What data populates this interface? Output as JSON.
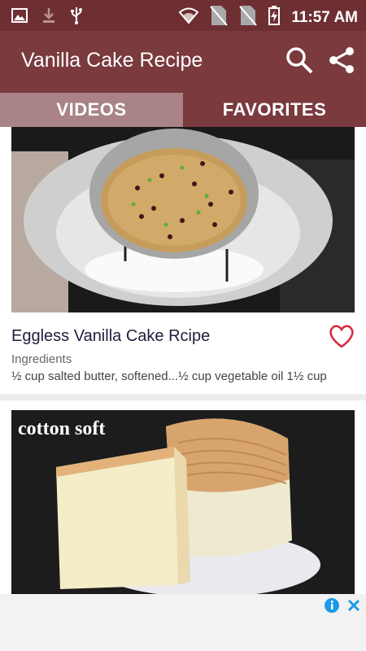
{
  "status_bar": {
    "time": "11:57 AM",
    "icons": [
      "image-icon",
      "download-icon",
      "usb-icon",
      "wifi-icon",
      "no-sim-icon",
      "no-sim-icon",
      "battery-charging-icon"
    ]
  },
  "app_bar": {
    "title": "Vanilla Cake Recipe",
    "icons": [
      "search-icon",
      "share-icon"
    ]
  },
  "tabs": [
    {
      "label": "VIDEOS",
      "active": false
    },
    {
      "label": "FAVORITES",
      "active": true
    }
  ],
  "recipes": [
    {
      "title": "Eggless Vanilla Cake Rcipe",
      "section": "Ingredients",
      "preview": "½ cup salted butter, softened...½ cup vegetable oil 1½ cup",
      "favorite_icon": "heart-outline-icon"
    },
    {
      "overlay_text": "cotton soft"
    }
  ],
  "ad_bar": {
    "icons": [
      "info-icon",
      "close-icon"
    ]
  },
  "colors": {
    "status_bar": "#6e2f33",
    "app_bar": "#7a3a3e",
    "tab_inactive": "#a98385",
    "heart": "#d7263d"
  }
}
